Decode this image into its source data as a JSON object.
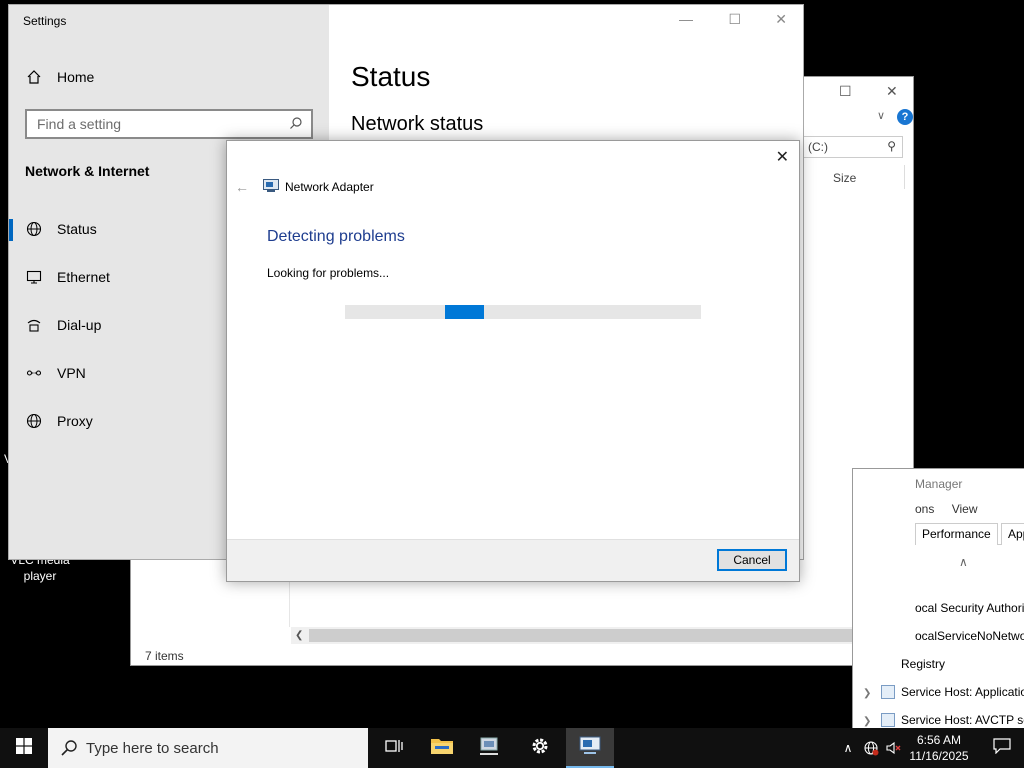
{
  "desktop": {
    "vlc_label": "VLC media player",
    "partial_label": "V"
  },
  "explorer": {
    "search_text": "(C:)",
    "column_size": "Size",
    "status": "7 items"
  },
  "taskmgr": {
    "title": "Manager",
    "menu": [
      "ons",
      "View"
    ],
    "tabs": [
      "Performance",
      "App"
    ],
    "rows": [
      "ocal Security Authorit",
      "ocalServiceNoNetwor",
      "Registry",
      "Service Host: Applicatio",
      "Service Host: AVCTP se"
    ]
  },
  "settings": {
    "window_title": "Settings",
    "home": "Home",
    "search_placeholder": "Find a setting",
    "section": "Network & Internet",
    "nav": [
      {
        "label": "Status",
        "icon": "globe-icon",
        "active": true
      },
      {
        "label": "Ethernet",
        "icon": "ethernet-icon",
        "active": false
      },
      {
        "label": "Dial-up",
        "icon": "dialup-icon",
        "active": false
      },
      {
        "label": "VPN",
        "icon": "vpn-icon",
        "active": false
      },
      {
        "label": "Proxy",
        "icon": "globe-icon",
        "active": false
      }
    ],
    "page_title": "Status",
    "page_subtitle": "Network status"
  },
  "dialog": {
    "adapter": "Network Adapter",
    "heading": "Detecting problems",
    "message": "Looking for problems...",
    "progress_segment": {
      "start": 0.28,
      "length": 0.11
    },
    "cancel_label": "Cancel"
  },
  "taskbar": {
    "search_placeholder": "Type here to search",
    "time": "6:56 AM",
    "date": "11/16/2025"
  },
  "colors": {
    "accent": "#0078d7",
    "dialog_heading": "#1e3d8f",
    "taskbar": "#101010"
  }
}
